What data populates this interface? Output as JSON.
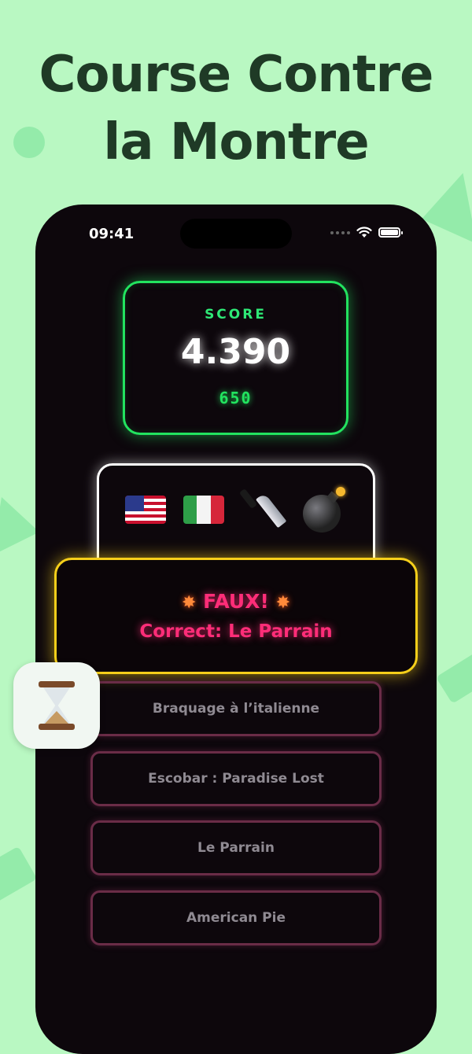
{
  "headline": {
    "line1": "Course Contre",
    "line2": "la Montre"
  },
  "status_bar": {
    "time": "09:41"
  },
  "score": {
    "label": "SCORE",
    "value": "4.390",
    "points": "650"
  },
  "clue": {
    "emojis": [
      "us-flag-icon",
      "italy-flag-icon",
      "knife-icon",
      "bomb-icon"
    ]
  },
  "result": {
    "status": "FAUX!",
    "correct_text": "Correct: Le Parrain",
    "accent_color": "#ff2d78",
    "border_color": "#f5cf1a"
  },
  "answers": [
    {
      "label": "Braquage à l’italienne"
    },
    {
      "label": "Escobar : Paradise Lost"
    },
    {
      "label": "Le Parrain"
    },
    {
      "label": "American Pie"
    }
  ],
  "badge": {
    "icon": "hourglass-icon"
  },
  "colors": {
    "background": "#b9f8c2",
    "phone": "#0d070c",
    "score_border": "#22e35f",
    "answer_border": "#6a2c47"
  }
}
